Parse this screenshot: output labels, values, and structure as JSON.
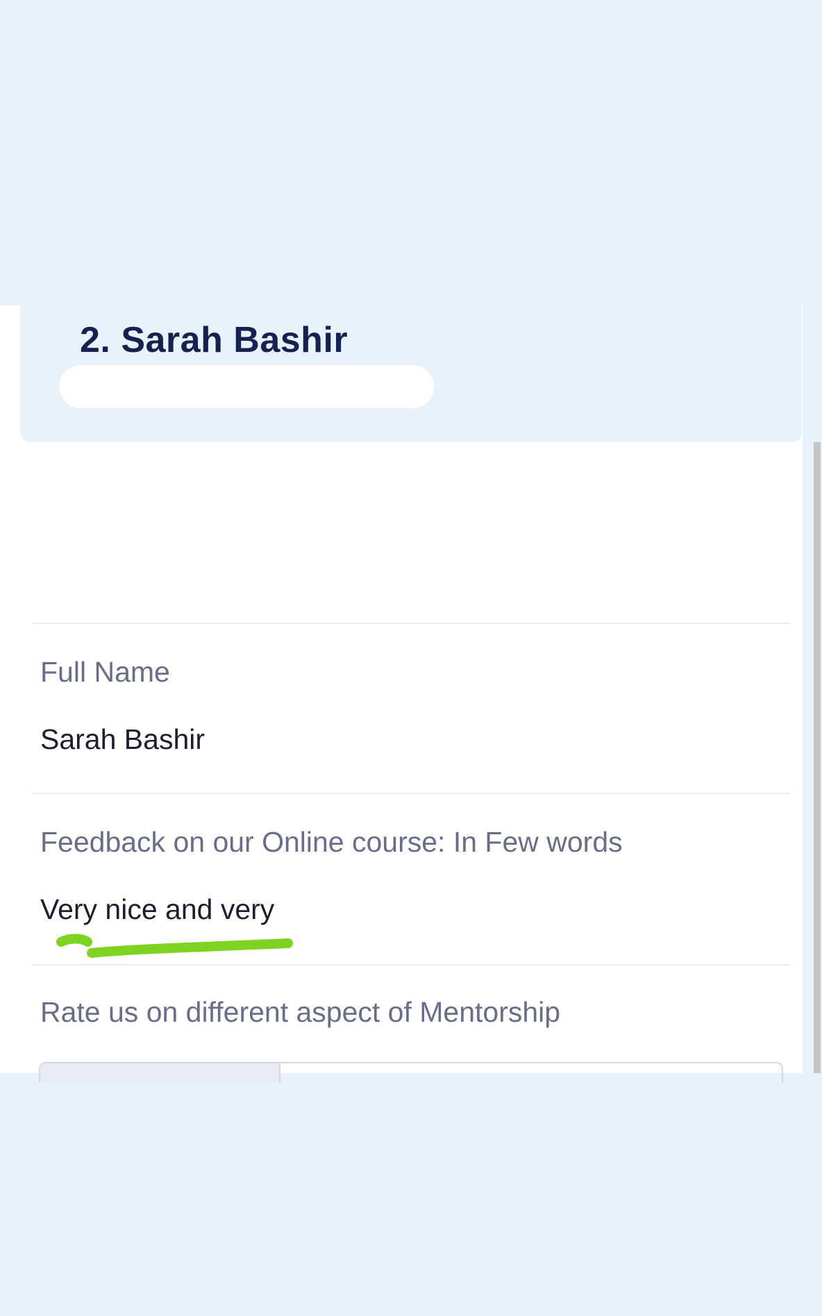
{
  "entry": {
    "title": "2. Sarah Bashir"
  },
  "fields": [
    {
      "label": "Full Name",
      "value": "Sarah Bashir"
    },
    {
      "label": "Feedback on our Online course: In Few words",
      "value": "Very nice and very"
    },
    {
      "label": "Rate us on different aspect of Mentorship"
    }
  ],
  "colors": {
    "background": "#e8f2fc",
    "title": "#15214f",
    "label": "#6a6d87",
    "value": "#1d1f2e",
    "highlight": "#7ed321"
  }
}
